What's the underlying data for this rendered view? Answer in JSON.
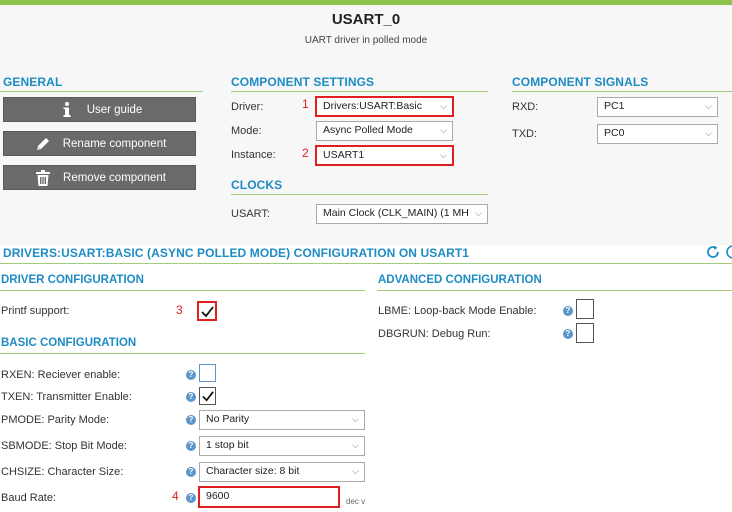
{
  "header": {
    "title": "USART_0",
    "subtitle": "UART driver in polled mode"
  },
  "general": {
    "heading": "GENERAL",
    "buttons": [
      "User guide",
      "Rename component",
      "Remove component"
    ]
  },
  "component_settings": {
    "heading": "COMPONENT SETTINGS",
    "driver": {
      "label": "Driver:",
      "value": "Drivers:USART:Basic",
      "marker": "1"
    },
    "mode": {
      "label": "Mode:",
      "value": "Async Polled Mode"
    },
    "instance": {
      "label": "Instance:",
      "value": "USART1",
      "marker": "2"
    }
  },
  "component_signals": {
    "heading": "COMPONENT SIGNALS",
    "rxd": {
      "label": "RXD:",
      "value": "PC1"
    },
    "txd": {
      "label": "TXD:",
      "value": "PC0"
    }
  },
  "clocks": {
    "heading": "CLOCKS",
    "usart": {
      "label": "USART:",
      "value": "Main Clock (CLK_MAIN) (1 MH"
    }
  },
  "configuration": {
    "heading": "DRIVERS:USART:BASIC (ASYNC POLLED MODE) CONFIGURATION ON USART1",
    "driver_config": {
      "heading": "DRIVER CONFIGURATION",
      "printf": {
        "label": "Printf support:",
        "checked": true,
        "marker": "3"
      }
    },
    "basic_config": {
      "heading": "BASIC CONFIGURATION",
      "rxen": {
        "label": "RXEN: Reciever enable:",
        "checked": false
      },
      "txen": {
        "label": "TXEN: Transmitter Enable:",
        "checked": true
      },
      "pmode": {
        "label": "PMODE: Parity Mode:",
        "value": "No Parity"
      },
      "sbmode": {
        "label": "SBMODE: Stop Bit Mode:",
        "value": "1 stop bit"
      },
      "chsize": {
        "label": "CHSIZE: Character Size:",
        "value": "Character size: 8 bit"
      },
      "baud": {
        "label": "Baud Rate:",
        "value": "9600",
        "marker": "4",
        "unit": "dec v"
      }
    },
    "advanced_config": {
      "heading": "ADVANCED CONFIGURATION",
      "lbme": {
        "label": "LBME: Loop-back Mode Enable:",
        "checked": false
      },
      "dbgrun": {
        "label": "DBGRUN: Debug Run:",
        "checked": false
      }
    }
  },
  "icons": {
    "help": "?",
    "chevron": "⌵"
  },
  "colors": {
    "accent_green": "#8bc34a",
    "heading_blue": "#1e8cc4",
    "highlight_red": "#e02020",
    "button_gray": "#6a6a6a"
  }
}
